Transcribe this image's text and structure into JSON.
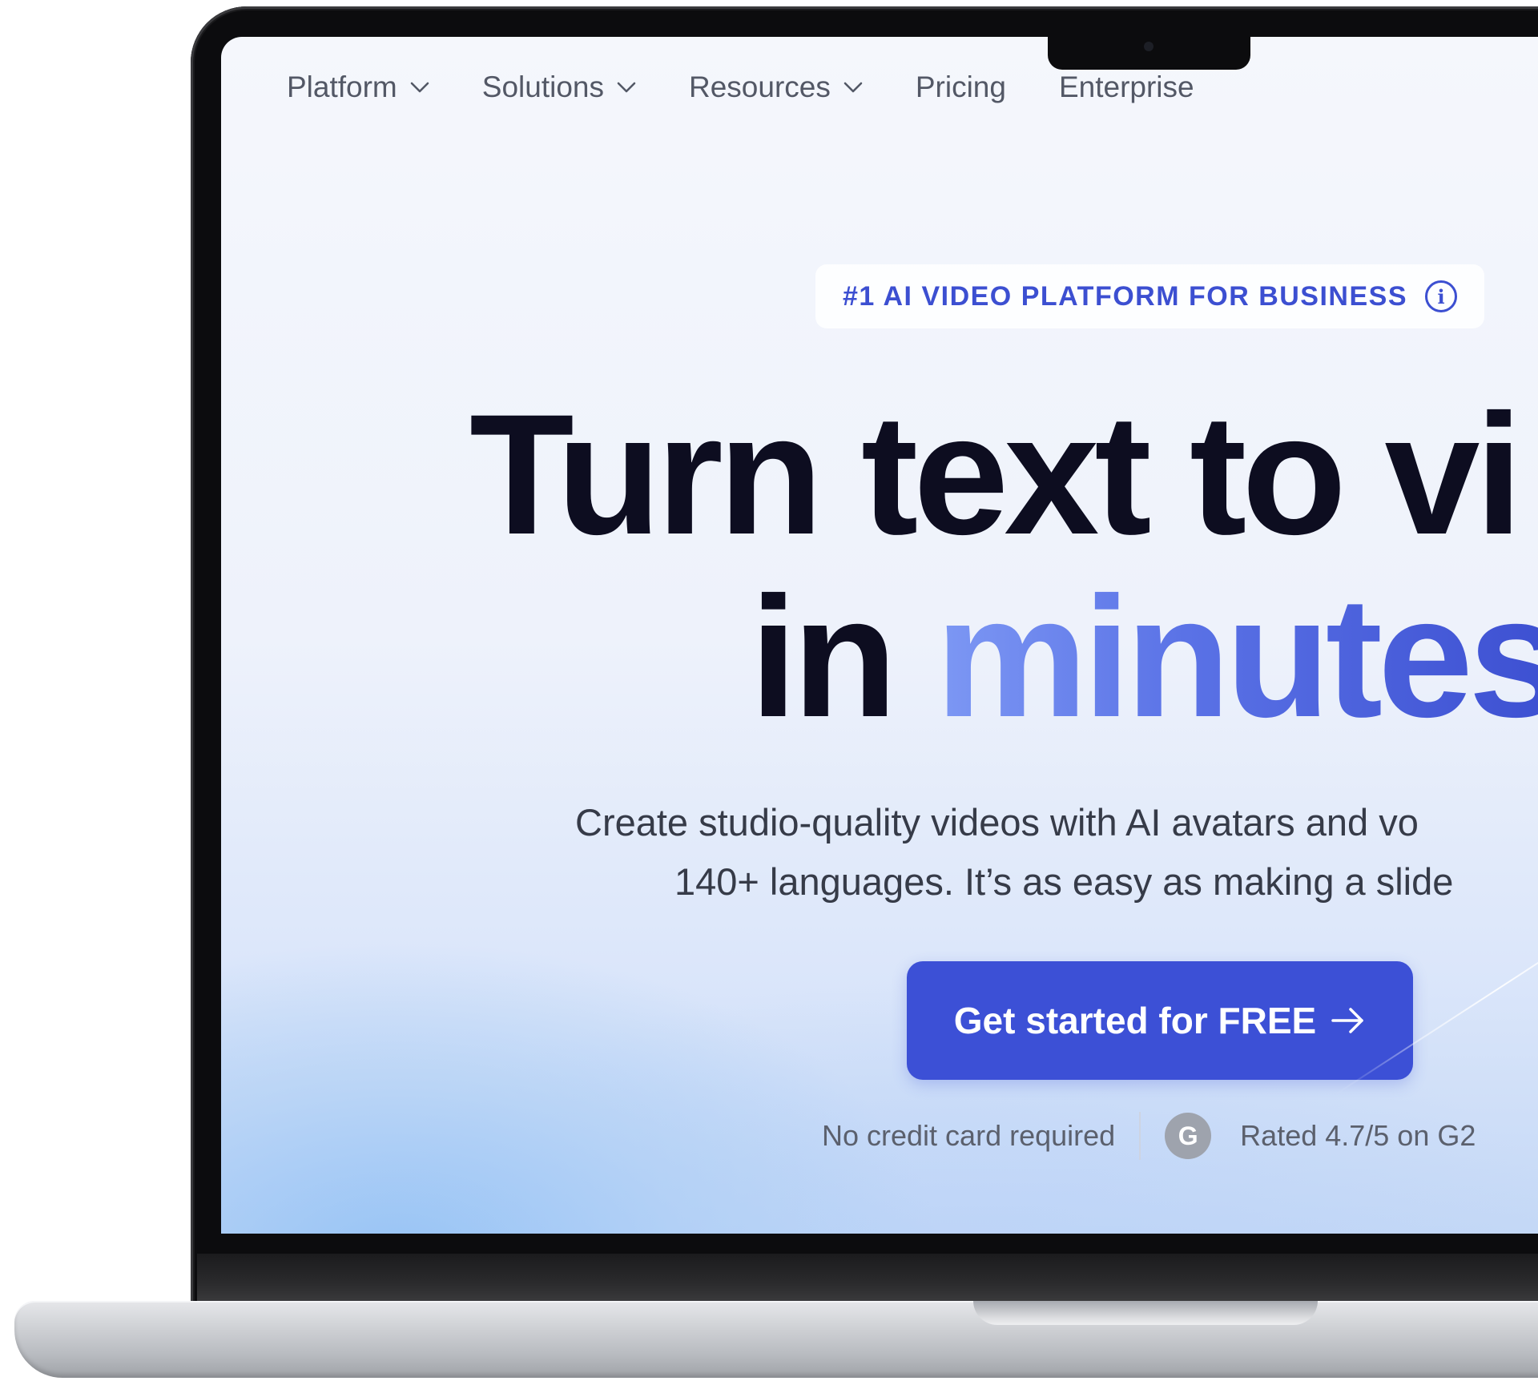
{
  "nav": {
    "items": [
      {
        "label": "Platform",
        "has_dropdown": true,
        "icon": "chevron-down-icon"
      },
      {
        "label": "Solutions",
        "has_dropdown": true,
        "icon": "chevron-down-icon"
      },
      {
        "label": "Resources",
        "has_dropdown": true,
        "icon": "chevron-down-icon"
      },
      {
        "label": "Pricing",
        "has_dropdown": false
      },
      {
        "label": "Enterprise",
        "has_dropdown": false
      }
    ]
  },
  "badge": {
    "text": "#1 AI VIDEO PLATFORM FOR BUSINESS",
    "icon": "info-icon",
    "info_glyph": "i"
  },
  "hero": {
    "headline_line1": "Turn text to vi",
    "headline_line2_prefix": "in ",
    "headline_line2_accent": "minutes",
    "subtitle_line1": "Create studio-quality videos with AI avatars and vo",
    "subtitle_line2": "140+ languages. It’s as easy as making a slide"
  },
  "cta": {
    "label": "Get started for FREE",
    "icon": "arrow-right-icon"
  },
  "meta": {
    "no_card": "No credit card required",
    "rating": "Rated 4.7/5 on G2",
    "g2_icon": "g2-logo-icon"
  },
  "colors": {
    "accent": "#3c50d6",
    "headline": "#0d0d20",
    "nav_text": "#535866"
  }
}
